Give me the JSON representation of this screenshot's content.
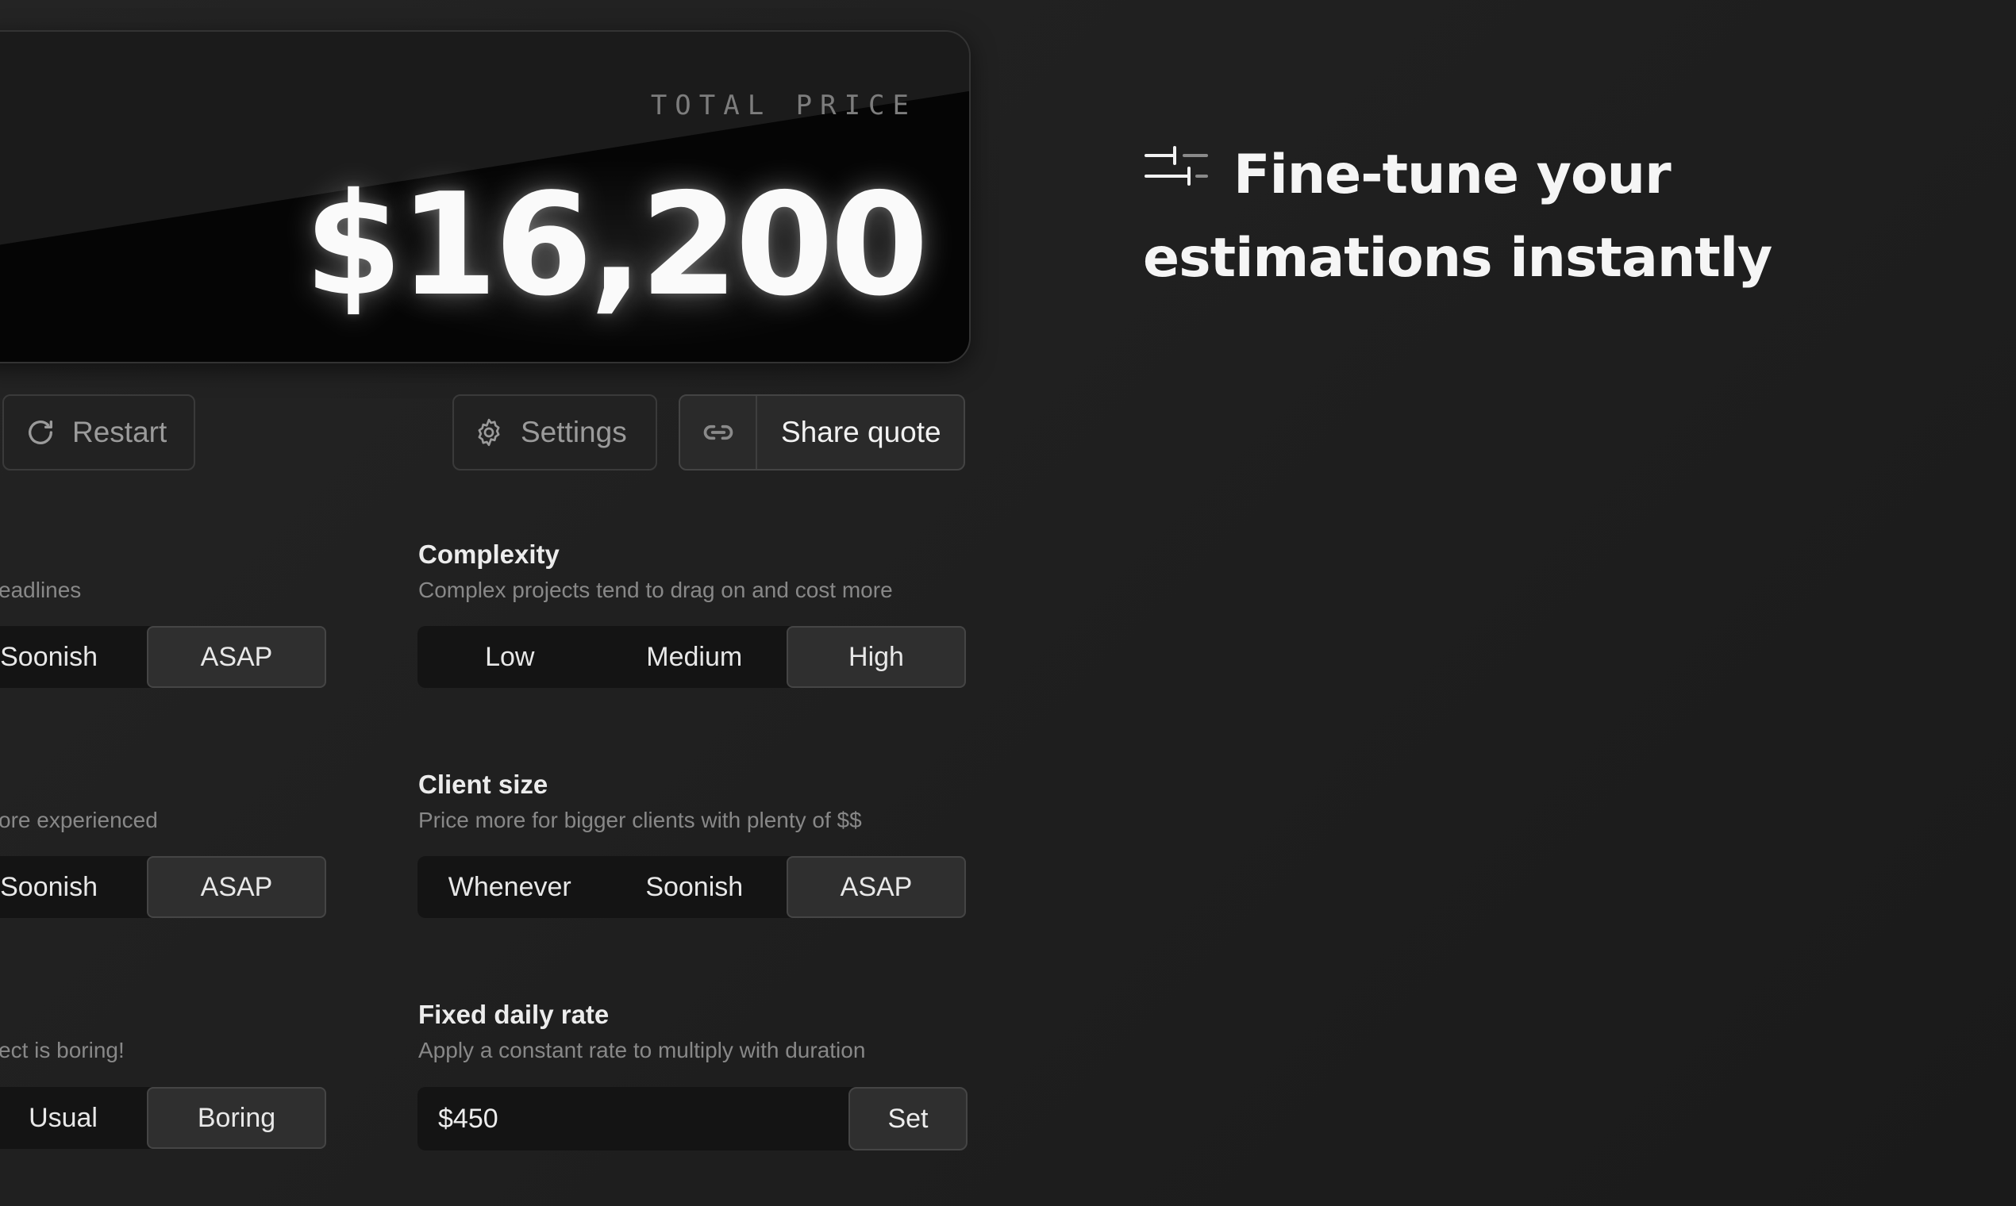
{
  "price_card": {
    "label": "TOTAL PRICE",
    "value": "$16,200"
  },
  "actions": {
    "restart_label": "Restart",
    "settings_label": "Settings",
    "share_label": "Share quote"
  },
  "left_column": {
    "row1": {
      "desc": "eadlines",
      "options": [
        "Soonish",
        "ASAP"
      ],
      "selected": "ASAP"
    },
    "row2": {
      "desc": "ore experienced",
      "options": [
        "Soonish",
        "ASAP"
      ],
      "selected": "ASAP"
    },
    "row3": {
      "desc": "ect is boring!",
      "options": [
        "Usual",
        "Boring"
      ],
      "selected": "Boring"
    }
  },
  "complexity": {
    "title": "Complexity",
    "desc": "Complex projects tend to drag on and cost more",
    "options": [
      "Low",
      "Medium",
      "High"
    ],
    "selected": "High"
  },
  "client_size": {
    "title": "Client size",
    "desc": "Price more for bigger clients with plenty of $$",
    "options": [
      "Whenever",
      "Soonish",
      "ASAP"
    ],
    "selected": "ASAP"
  },
  "daily_rate": {
    "title": "Fixed daily rate",
    "desc": "Apply a constant rate to multiply with duration",
    "value": "$450",
    "set_label": "Set"
  },
  "headline": {
    "line1": "Fine-tune your",
    "line2": "estimations instantly",
    "icon": "sliders-icon"
  },
  "colors": {
    "background": "#212121",
    "card_dark": "#050505",
    "text": "#ededed",
    "muted": "#888888",
    "selected_option": "#2f2f2f"
  }
}
